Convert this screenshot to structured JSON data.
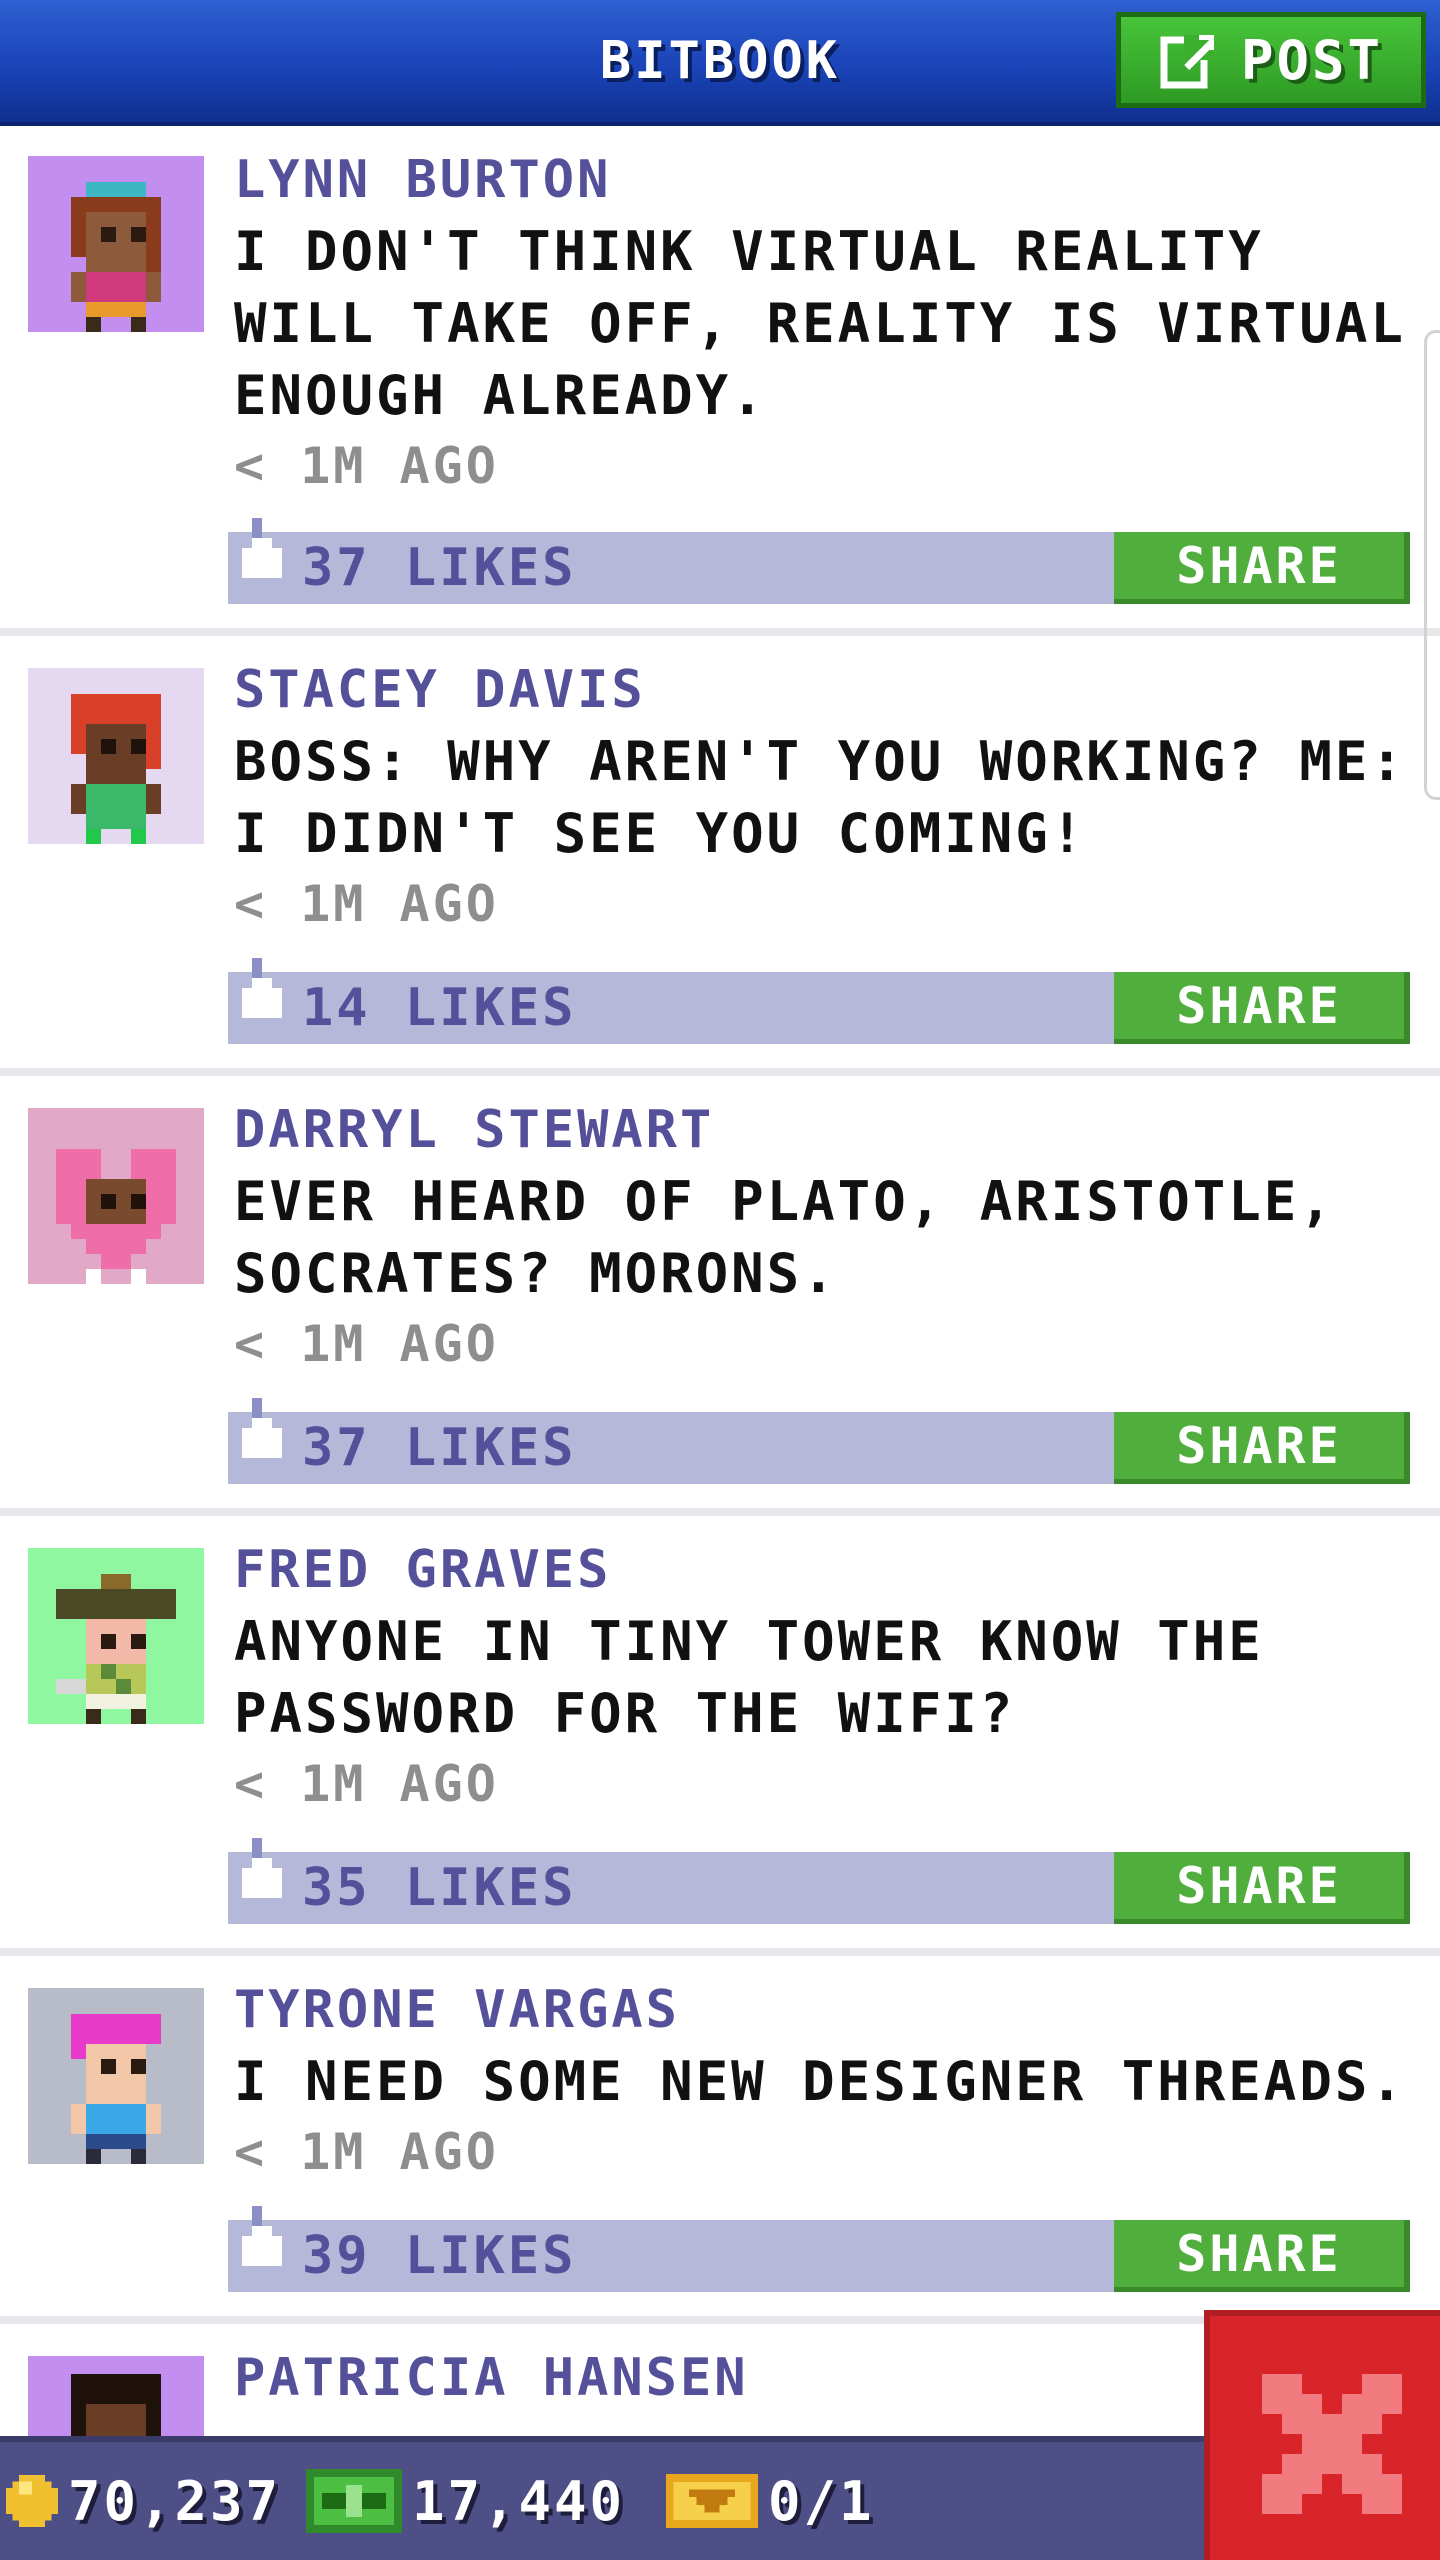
{
  "header": {
    "title": "BITBOOK",
    "post_label": "POST"
  },
  "posts": [
    {
      "author": "LYNN BURTON",
      "message": "I DON'T THINK VIRTUAL REALITY WILL TAKE OFF, REALITY IS VIRTUAL ENOUGH ALREADY.",
      "time": "< 1M AGO",
      "likes": "37 LIKES",
      "share_label": "SHARE",
      "avatar_bg": "#c28ff0"
    },
    {
      "author": "STACEY DAVIS",
      "message": "BOSS: WHY AREN'T YOU WORKING? ME: I DIDN'T SEE YOU COMING!",
      "time": "< 1M AGO",
      "likes": "14 LIKES",
      "share_label": "SHARE",
      "avatar_bg": "#e4d9f0"
    },
    {
      "author": "DARRYL STEWART",
      "message": "EVER HEARD OF PLATO, ARISTOTLE, SOCRATES? MORONS.",
      "time": "< 1M AGO",
      "likes": "37 LIKES",
      "share_label": "SHARE",
      "avatar_bg": "#e2a8c8"
    },
    {
      "author": "FRED GRAVES",
      "message": "ANYONE IN TINY TOWER KNOW THE PASSWORD FOR THE WIFI?",
      "time": "< 1M AGO",
      "likes": "35 LIKES",
      "share_label": "SHARE",
      "avatar_bg": "#8ff7a0"
    },
    {
      "author": "TYRONE VARGAS",
      "message": "I NEED SOME NEW DESIGNER THREADS.",
      "time": "< 1M AGO",
      "likes": "39 LIKES",
      "share_label": "SHARE",
      "avatar_bg": "#b8bcc8"
    },
    {
      "author": "PATRICIA HANSEN",
      "avatar_bg": "#c28ff0"
    }
  ],
  "status": {
    "coins": "70,237",
    "bux": "17,440",
    "tickets": "0/1"
  },
  "icons": {
    "post": "edit-icon",
    "like": "thumb-up-icon",
    "coin": "coin-icon",
    "bux": "bux-icon",
    "ticket": "ticket-icon",
    "close": "close-icon"
  },
  "colors": {
    "header": "#1a44b8",
    "post_button": "#3cb02e",
    "share_button": "#4fae3c",
    "likes_bar": "#b6b8d9",
    "author_text": "#55509a",
    "status_bar": "#4f4f87",
    "close_button": "#d9252a"
  }
}
